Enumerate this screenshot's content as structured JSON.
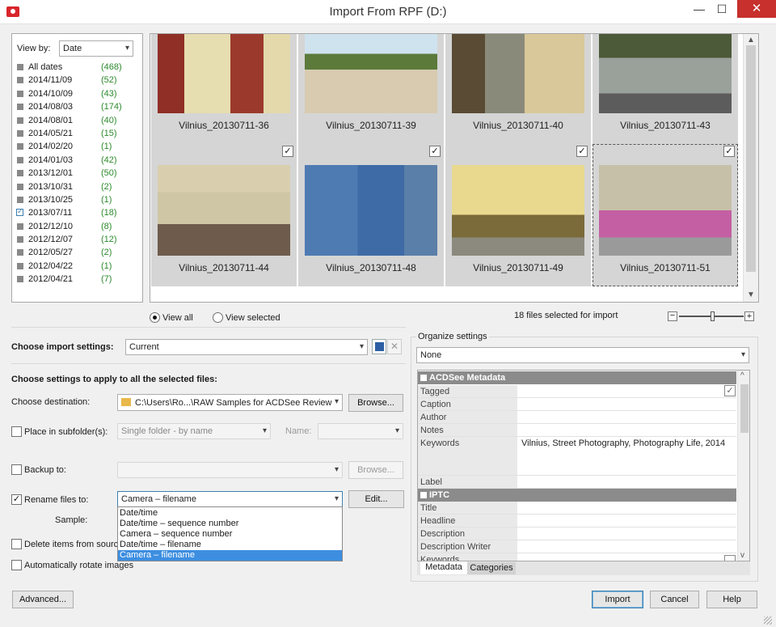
{
  "window": {
    "title": "Import From RPF (D:)"
  },
  "viewby": {
    "label": "View by:",
    "value": "Date"
  },
  "dates": [
    {
      "label": "All dates",
      "count": "(468)"
    },
    {
      "label": "2014/11/09",
      "count": "(52)"
    },
    {
      "label": "2014/10/09",
      "count": "(43)"
    },
    {
      "label": "2014/08/03",
      "count": "(174)"
    },
    {
      "label": "2014/08/01",
      "count": "(40)"
    },
    {
      "label": "2014/05/21",
      "count": "(15)"
    },
    {
      "label": "2014/02/20",
      "count": "(1)"
    },
    {
      "label": "2014/01/03",
      "count": "(42)"
    },
    {
      "label": "2013/12/01",
      "count": "(50)"
    },
    {
      "label": "2013/10/31",
      "count": "(2)"
    },
    {
      "label": "2013/10/25",
      "count": "(1)"
    },
    {
      "label": "2013/07/11",
      "count": "(18)",
      "checked": true
    },
    {
      "label": "2012/12/10",
      "count": "(8)"
    },
    {
      "label": "2012/12/07",
      "count": "(12)"
    },
    {
      "label": "2012/05/27",
      "count": "(2)"
    },
    {
      "label": "2012/04/22",
      "count": "(1)"
    },
    {
      "label": "2012/04/21",
      "count": "(7)"
    }
  ],
  "thumbs": [
    {
      "name": "Vilnius_20130711-36",
      "checked": false
    },
    {
      "name": "Vilnius_20130711-39",
      "checked": false
    },
    {
      "name": "Vilnius_20130711-40",
      "checked": false
    },
    {
      "name": "Vilnius_20130711-43",
      "checked": false
    },
    {
      "name": "Vilnius_20130711-44",
      "checked": true
    },
    {
      "name": "Vilnius_20130711-48",
      "checked": true
    },
    {
      "name": "Vilnius_20130711-49",
      "checked": true
    },
    {
      "name": "Vilnius_20130711-51",
      "checked": true
    }
  ],
  "view": {
    "all": "View all",
    "selected": "View selected",
    "status": "18 files selected for import"
  },
  "import_settings": {
    "label": "Choose import settings:",
    "value": "Current"
  },
  "apply_heading": "Choose settings to apply to all the selected files:",
  "destination": {
    "label": "Choose destination:",
    "value": "C:\\Users\\Ro...\\RAW Samples for ACDSee Review",
    "browse": "Browse..."
  },
  "subfolder": {
    "label": "Place in subfolder(s):",
    "value": "Single folder - by name",
    "name_label": "Name:"
  },
  "backup": {
    "label": "Backup to:",
    "browse": "Browse..."
  },
  "rename": {
    "label": "Rename files to:",
    "value": "Camera – filename",
    "edit": "Edit...",
    "sample_label": "Sample:",
    "options": [
      "Date/time",
      "Date/time – sequence number",
      "Camera – sequence number",
      "Date/time – filename",
      "Camera – filename"
    ]
  },
  "delete_label": "Delete items from source",
  "rotate_label": "Automatically rotate images",
  "organize": {
    "label": "Organize settings",
    "value": "None"
  },
  "metadata": {
    "acdsee_header": "ACDSee Metadata",
    "acdsee_fields": [
      "Tagged",
      "Caption",
      "Author",
      "Notes"
    ],
    "keywords_label": "Keywords",
    "keywords_value": "Vilnius, Street Photography, Photography Life, 2014",
    "label_field": "Label",
    "iptc_header": "IPTC",
    "iptc_fields": [
      "Title",
      "Headline",
      "Description",
      "Description Writer",
      "Keywords"
    ]
  },
  "tabs": {
    "metadata": "Metadata",
    "categories": "Categories"
  },
  "buttons": {
    "advanced": "Advanced...",
    "import": "Import",
    "cancel": "Cancel",
    "help": "Help"
  }
}
